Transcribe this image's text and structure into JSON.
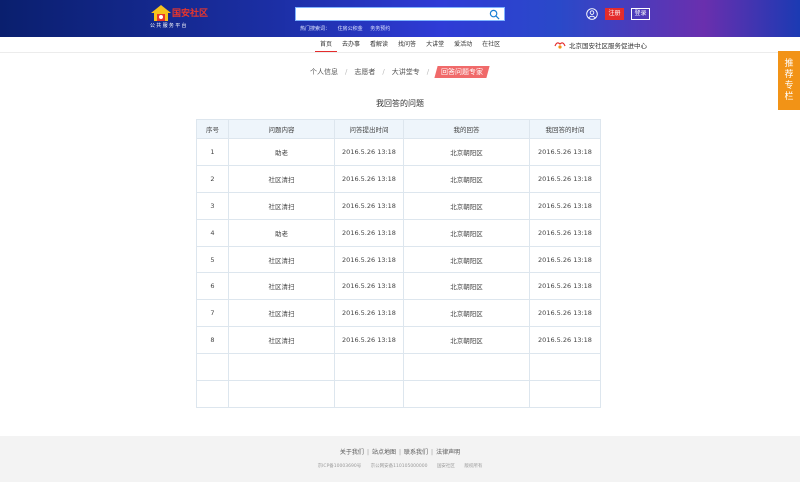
{
  "header": {
    "logo_name": "国安社区",
    "logo_sub": "公共服务平台",
    "search_placeholder": "",
    "hot": [
      "热门搜索词：",
      "住房公积金",
      "务务预约"
    ],
    "register_label": "注册",
    "login_label": "登录"
  },
  "nav": {
    "items": [
      "首页",
      "去办事",
      "看解读",
      "找问答",
      "大讲堂",
      "爱活动",
      "在社区"
    ],
    "right_text": "北京国安社区服务促进中心"
  },
  "side_tab": "推荐专栏",
  "breadcrumb": [
    "个人信息",
    "志愿者",
    "大讲堂专",
    "回答问题专家"
  ],
  "page_title": "我回答的问题",
  "table": {
    "headers": [
      "序号",
      "问题内容",
      "问答提出时间",
      "我的回答",
      "我回答的时间"
    ],
    "rows": [
      [
        "1",
        "助老",
        "2016.5.26 13:18",
        "北京朝阳区",
        "2016.5.26 13:18"
      ],
      [
        "2",
        "社区清扫",
        "2016.5.26 13:18",
        "北京朝阳区",
        "2016.5.26 13:18"
      ],
      [
        "3",
        "社区清扫",
        "2016.5.26 13:18",
        "北京朝阳区",
        "2016.5.26 13:18"
      ],
      [
        "4",
        "助老",
        "2016.5.26 13:18",
        "北京朝阳区",
        "2016.5.26 13:18"
      ],
      [
        "5",
        "社区清扫",
        "2016.5.26 13:18",
        "北京朝阳区",
        "2016.5.26 13:18"
      ],
      [
        "6",
        "社区清扫",
        "2016.5.26 13:18",
        "北京朝阳区",
        "2016.5.26 13:18"
      ],
      [
        "7",
        "社区清扫",
        "2016.5.26 13:18",
        "北京朝阳区",
        "2016.5.26 13:18"
      ],
      [
        "8",
        "社区清扫",
        "2016.5.26 13:18",
        "北京朝阳区",
        "2016.5.26 13:18"
      ],
      [
        "",
        "",
        "",
        "",
        ""
      ],
      [
        "",
        "",
        "",
        "",
        ""
      ]
    ]
  },
  "footer": {
    "links": [
      "关于我们",
      "站点地图",
      "联系我们",
      "法律声明"
    ],
    "copy": [
      "京ICP备10003690号",
      "京公网安备110105000000",
      "国安社区",
      "版权所有"
    ]
  },
  "colors": {
    "accent": "#e42c2c",
    "side_tab": "#f29316",
    "header_dark": "#0a1f6e"
  }
}
